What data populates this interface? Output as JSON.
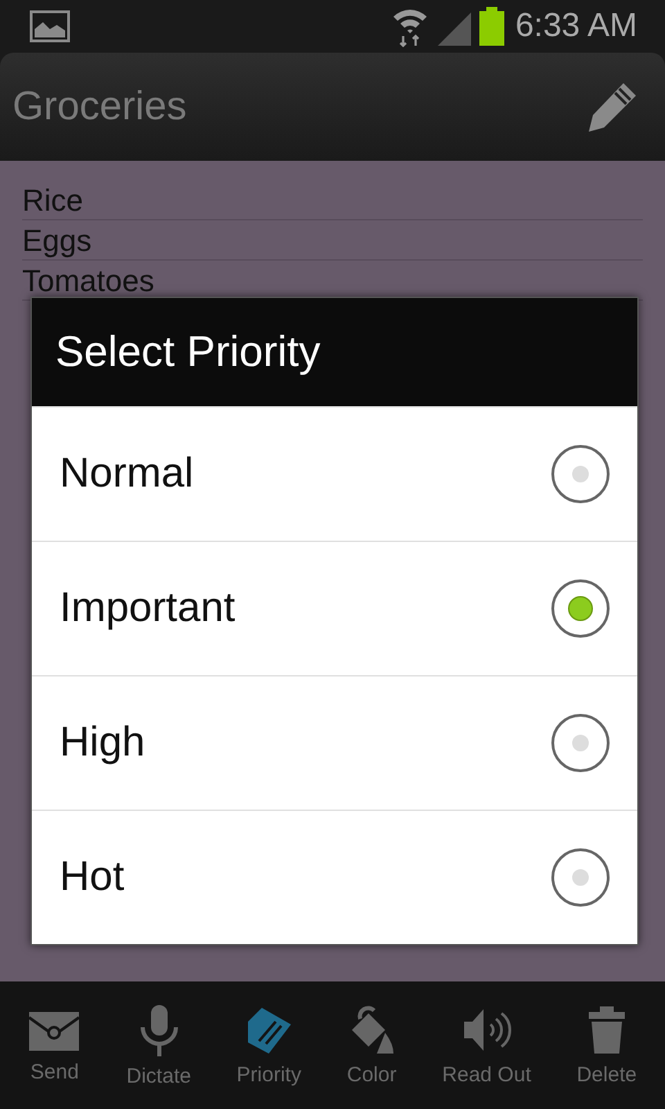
{
  "status_bar": {
    "time": "6:33 AM"
  },
  "header": {
    "title": "Groceries"
  },
  "list": {
    "items": [
      "Rice",
      "Eggs",
      "Tomatoes"
    ]
  },
  "dialog": {
    "title": "Select Priority",
    "options": [
      {
        "label": "Normal",
        "selected": false
      },
      {
        "label": "Important",
        "selected": true
      },
      {
        "label": "High",
        "selected": false
      },
      {
        "label": "Hot",
        "selected": false
      }
    ]
  },
  "toolbar": [
    {
      "label": "Send",
      "selected": false
    },
    {
      "label": "Dictate",
      "selected": false
    },
    {
      "label": "Priority",
      "selected": true
    },
    {
      "label": "Color",
      "selected": false
    },
    {
      "label": "Read Out",
      "selected": false
    },
    {
      "label": "Delete",
      "selected": false
    }
  ]
}
